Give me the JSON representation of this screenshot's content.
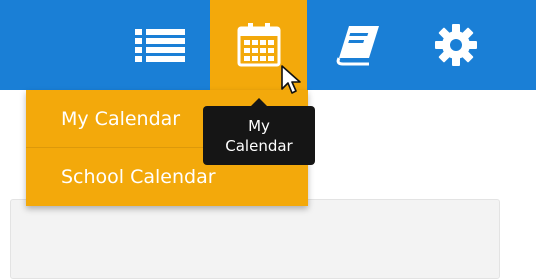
{
  "nav": {
    "icons": [
      "list-icon",
      "calendar-icon",
      "book-icon",
      "gear-icon"
    ],
    "active": "calendar-icon"
  },
  "dropdown": {
    "items": [
      {
        "label": "My Calendar"
      },
      {
        "label": "School Calendar"
      }
    ]
  },
  "tooltip": {
    "line1": "My",
    "line2": "Calendar"
  },
  "colors": {
    "topbar": "#1a7fd6",
    "accent": "#f3a90b",
    "tooltip_bg": "#151515"
  }
}
